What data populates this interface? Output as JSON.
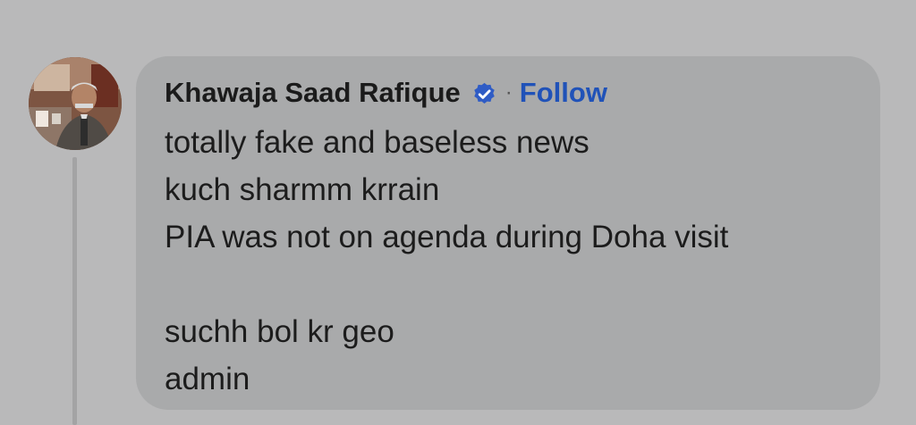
{
  "comment": {
    "author": "Khawaja Saad Rafique",
    "verified_icon": "verified-badge-icon",
    "separator": "·",
    "follow_label": "Follow",
    "lines": [
      "totally fake and baseless news",
      "kuch sharmm krrain",
      "PIA was not on  agenda during Doha visit",
      "",
      "suchh bol kr geo",
      "admin"
    ]
  },
  "colors": {
    "background": "#b9b9ba",
    "bubble": "#a9aaab",
    "follow": "#2052b8",
    "verified_badge": "#2f5cc5",
    "text": "#1c1c1c"
  }
}
